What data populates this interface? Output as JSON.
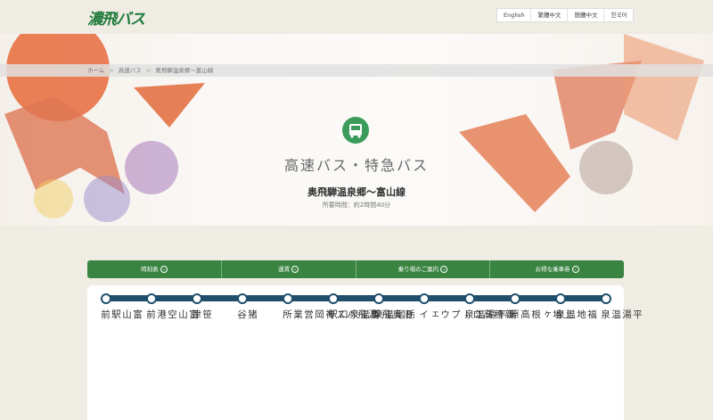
{
  "header": {
    "logo_text": "濃飛バス",
    "languages": [
      "English",
      "繁體中文",
      "簡體中文",
      "한국어"
    ]
  },
  "breadcrumb": [
    "ホーム",
    "高速バス",
    "奥飛騨温泉郷〜富山線"
  ],
  "hero": {
    "icon": "bus-icon",
    "title": "高速バス・特急バス",
    "route_name": "奥飛騨温泉郷〜富山線",
    "duration": "所要時間：約2時間40分"
  },
  "tabs": [
    {
      "label": "時刻表"
    },
    {
      "label": "運賃"
    },
    {
      "label": "乗り場のご案内"
    },
    {
      "label": "お得な乗車券"
    }
  ],
  "stops": [
    "富山駅前",
    "富山空港前",
    "笹津",
    "猪谷",
    "濃飛バス神岡営業所",
    "旧奥飛騨温泉口駅",
    "栃尾温泉",
    "新穂高ロープウェイ",
    "新平湯温泉",
    "上地ヶ根高原",
    "福地温泉",
    "平湯温泉"
  ],
  "colors": {
    "brand_green": "#3a8442",
    "route_line": "#1f4f6c"
  }
}
